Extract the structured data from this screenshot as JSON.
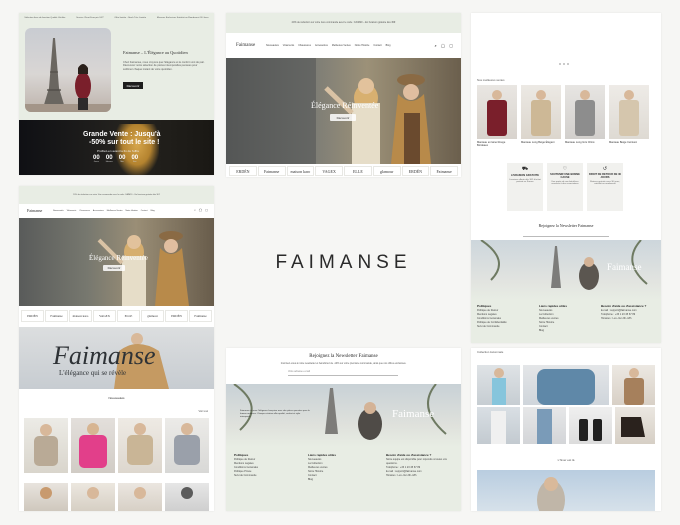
{
  "center_logo": "FAIMANSE",
  "panel_a": {
    "promo_items": [
      "Sélection fixes de fonction Qualité Vérifiée",
      "Service Client Français 24/7",
      "Offre limitée - Stock Très Limitée",
      "Mesures Exclusives Satisfait ou Remboursé 30 Jours"
    ],
    "headline": "Faimanse – L'Élégance au Quotidien",
    "body": "Chez Faimanse, nous croyons que l'élégance et le confort vont de pair. Découvrez notre sélection de pièces intemporelles pensées pour sublimer chaque instant de votre quotidien.",
    "cta": "Découvrir",
    "sale_title_1": "Grande Vente : Jusqu'à",
    "sale_title_2": "-50% sur tout le site !",
    "sale_sub": "Profitez-en avant la fin de l'offre",
    "countdown": [
      "00",
      "00",
      "00",
      "00"
    ],
    "countdown_units": [
      "Jours",
      "Heures",
      "Min",
      "Sec"
    ]
  },
  "panel_b": {
    "announcement": "20% de réduction sur votre 1ère commande avec le code : FAIM20 – En livraison gratuite dès 30€",
    "logo": "Faimanse",
    "nav": [
      "Nouveautés",
      "Vêtements",
      "Chaussures",
      "Accessoires",
      "Meilleures Ventes",
      "Notre Histoire",
      "Contact",
      "Blog"
    ],
    "hero_title": "Élégance Réinventée",
    "hero_cta": "Découvrir",
    "brands": [
      "ERDÉN",
      "Faimanse",
      "maison karo",
      "VAGEX",
      "ELLE",
      "glamour",
      "ERDÉN",
      "Faimanse"
    ]
  },
  "panel_c": {
    "announcement": "20% de réduction sur votre 1ère commande avec le code : FAIM20 – En livraison gratuite dès 30€",
    "logo": "Faimanse",
    "nav": [
      "Nouveautés",
      "Vêtements",
      "Chaussures",
      "Accessoires",
      "Meilleures Ventes",
      "Notre Histoire",
      "Contact",
      "Blog"
    ],
    "hero_title": "Élégance Réinventée",
    "hero_cta": "Découvrir",
    "brands": [
      "ERDÉN",
      "Faimanse",
      "maison karo",
      "VAGEX",
      "ELLE",
      "glamour",
      "ERDÉN",
      "Faimanse"
    ],
    "banner_word": "Faimanse",
    "banner_sub": "L'élégance qui se révèle",
    "section_title": "Nouveautés",
    "view_all": "Voir tout"
  },
  "panel_d": {
    "section_title": "Nos meilleures ventes",
    "products": [
      "Manteau en laine Rouge Bordeaux",
      "Manteau Long Beige Élégant",
      "Manteau Long Gris Chiné",
      "Manteau Beige Ceinturé"
    ],
    "features": [
      {
        "title": "LIVRAISON GRATUITE",
        "text": "Livraison offerte dès 30€ d'achat partout en France"
      },
      {
        "title": "SOUTENIR UNE BONNE CAUSE",
        "text": "Une partie de nos bénéfices reversée à des associations"
      },
      {
        "title": "DROIT DE RETOUR DE 30 JOURS",
        "text": "Retours gratuits sous 30 jours, satisfait ou remboursé"
      }
    ],
    "newsletter_title": "Rejoignez la Newsletter Faimanse",
    "footer_cols": [
      {
        "title": "Politiques",
        "items": [
          "Politique de Retour",
          "Mentions Légales",
          "Conditions Générales",
          "Politique de Confidentialité",
          "Suivi de Commande"
        ]
      },
      {
        "title": "Liens rapides utiles",
        "items": [
          "Nouveautés",
          "La Collection",
          "Meilleures ventes",
          "Notre Histoire",
          "Contact",
          "Blog"
        ]
      },
      {
        "title": "Besoin d'aide ou d'assistance ?",
        "items": [
          "E-mail : support@faimanse.com",
          "Téléphone : +33 1 23 45 67 89",
          "Horaires : Lun–Ven 9h–18h"
        ]
      }
    ],
    "banner_word": "Faimanse"
  },
  "panel_e": {
    "newsletter_title": "Rejoignez la Newsletter Faimanse",
    "newsletter_text": "Inscrivez-vous à notre newsletter et bénéficiez de -10% sur votre première commande, ainsi que nos offres exclusives.",
    "email_placeholder": "Votre adresse e-mail",
    "banner_word": "Faimanse",
    "banner_text": "Faimanse incarne l'élégance française avec des pièces pensées pour la femme moderne. Chaque création allie qualité, confort et style intemporel.",
    "footer_cols": [
      {
        "title": "Politiques",
        "items": [
          "Politique de Retour",
          "Mentions Légales",
          "Conditions Générales",
          "Politique Privée",
          "Suivi de Commande"
        ]
      },
      {
        "title": "Liens rapides utiles",
        "items": [
          "Nouveautés",
          "La Collection",
          "Meilleures ventes",
          "Notre Histoire",
          "Contact",
          "Blog"
        ]
      },
      {
        "title": "Besoin d'aide ou d'assistance ?",
        "items": [
          "Notre équipe est disponible pour répondre à toutes vos questions.",
          "Téléphone : +33 1 23 45 67 89",
          "E-mail : support@faimanse.com",
          "Horaires : Lun–Ven 9h–18h"
        ]
      }
    ]
  },
  "panel_f": {
    "section_title": "Collection Automnale",
    "subtitle": "L'hiver est là"
  }
}
